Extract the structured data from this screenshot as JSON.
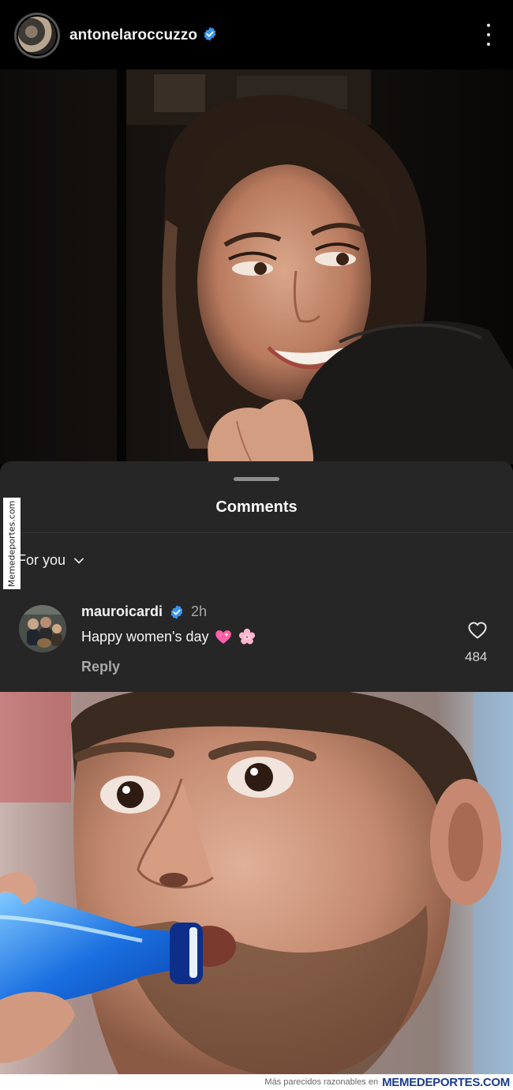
{
  "post": {
    "username": "antonelaroccuzzo",
    "verified": true,
    "more_icon": "more-vertical-icon"
  },
  "comments_sheet": {
    "title": "Comments",
    "sort_label": "For you",
    "sort_icon": "chevron-down-icon",
    "comments": [
      {
        "username": "mauroicardi",
        "verified": true,
        "time": "2h",
        "text": "Happy women's day",
        "emojis": [
          "sparkling-heart-icon",
          "cherry-blossom-icon"
        ],
        "reply_label": "Reply",
        "likes": "484",
        "like_icon": "heart-outline-icon"
      }
    ]
  },
  "watermark": {
    "side_text": "Memedeportes.com",
    "footer_text": "Más parecidos razonables en",
    "footer_brand": "MEMEDEPORTES.COM"
  },
  "colors": {
    "sheet_background": "#262626",
    "verified_blue": "#3897f0",
    "secondary_text": "#a8a8a8"
  }
}
